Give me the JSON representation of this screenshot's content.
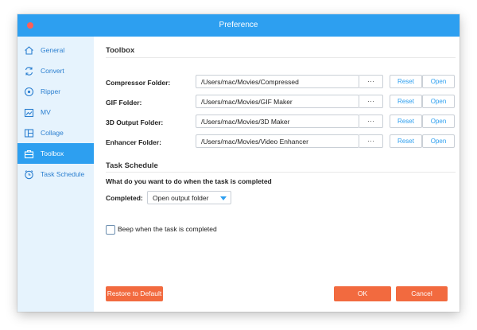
{
  "window": {
    "title": "Preference"
  },
  "sidebar": {
    "items": [
      {
        "label": "General",
        "icon": "home-icon"
      },
      {
        "label": "Convert",
        "icon": "convert-icon"
      },
      {
        "label": "Ripper",
        "icon": "disc-icon"
      },
      {
        "label": "MV",
        "icon": "mv-icon"
      },
      {
        "label": "Collage",
        "icon": "collage-icon"
      },
      {
        "label": "Toolbox",
        "icon": "toolbox-icon",
        "active": true
      },
      {
        "label": "Task Schedule",
        "icon": "clock-icon"
      }
    ]
  },
  "toolbox": {
    "title": "Toolbox",
    "rows": [
      {
        "label": "Compressor Folder:",
        "path": "/Users/mac/Movies/Compressed"
      },
      {
        "label": "GIF Folder:",
        "path": "/Users/mac/Movies/GIF Maker"
      },
      {
        "label": "3D Output Folder:",
        "path": "/Users/mac/Movies/3D Maker"
      },
      {
        "label": "Enhancer Folder:",
        "path": "/Users/mac/Movies/Video Enhancer"
      }
    ],
    "dots_label": "···",
    "reset_label": "Reset",
    "open_label": "Open"
  },
  "task_schedule": {
    "title": "Task Schedule",
    "question": "What do you want to do when the task is completed",
    "completed_label": "Completed:",
    "completed_value": "Open output folder",
    "beep_label": "Beep when the task is completed",
    "beep_checked": false
  },
  "footer": {
    "restore_label": "Restore to Default",
    "ok_label": "OK",
    "cancel_label": "Cancel"
  },
  "colors": {
    "accent": "#2d9ff0",
    "orange": "#f26a3f",
    "sidebar_bg": "#e6f3fd"
  }
}
